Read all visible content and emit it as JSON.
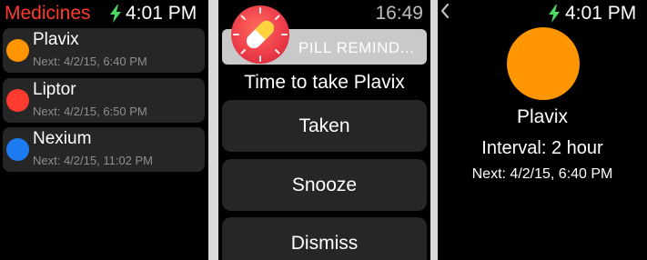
{
  "colors": {
    "medicines_title": "#ff3b30",
    "charging": "#4cd964",
    "plavix": "#ff9500",
    "liptor": "#ff3b30",
    "nexium": "#1e7cf2"
  },
  "list_screen": {
    "title": "Medicines",
    "time": "4:01 PM",
    "status_icon": "charging-bolt-icon",
    "medicines": [
      {
        "name": "Plavix",
        "next": "Next: 4/2/15, 6:40 PM",
        "color": "#ff9500"
      },
      {
        "name": "Liptor",
        "next": "Next: 4/2/15, 6:50 PM",
        "color": "#ff3b30"
      },
      {
        "name": "Nexium",
        "next": "Next: 4/2/15, 11:02 PM",
        "color": "#1e7cf2"
      }
    ]
  },
  "notification_screen": {
    "time": "16:49",
    "app_icon": "pill-icon",
    "app_name": "PILL REMIND...",
    "message": "Time to take Plavix",
    "actions": [
      "Taken",
      "Snooze",
      "Dismiss"
    ]
  },
  "detail_screen": {
    "time": "4:01 PM",
    "back_icon": "chevron-left-icon",
    "status_icon": "charging-bolt-icon",
    "name": "Plavix",
    "interval": "Interval: 2 hour",
    "next": "Next: 4/2/15, 6:40 PM",
    "color": "#ff9500"
  }
}
